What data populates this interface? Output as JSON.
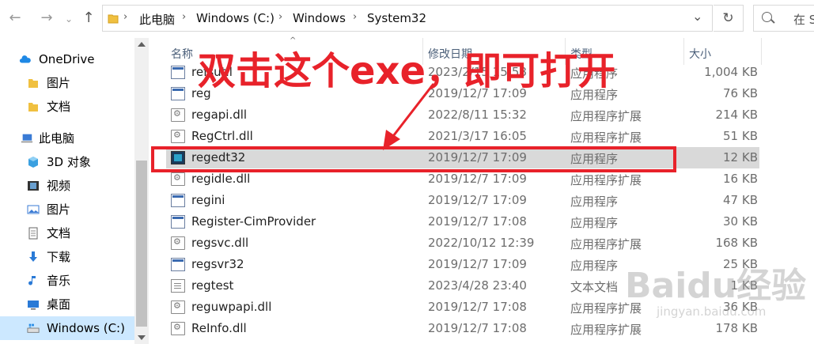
{
  "addressbar": {
    "back_glyph": "←",
    "forward_glyph": "→",
    "up_glyph": "↑",
    "path": [
      "此电脑",
      "Windows (C:)",
      "Windows",
      "System32"
    ],
    "separator": "›",
    "dropdown_glyph": "⌄",
    "refresh_glyph": "↻",
    "search_placeholder": "在 S"
  },
  "sidebar": {
    "items": [
      {
        "label": "OneDrive",
        "icon": "cloud-icon",
        "color": "#1e88e5"
      },
      {
        "label": "图片",
        "icon": "folder-icon",
        "color": "#f0c040"
      },
      {
        "label": "文档",
        "icon": "folder-icon",
        "color": "#f0c040"
      },
      {
        "label": "此电脑",
        "icon": "computer-icon",
        "color": "#3a7bd5"
      },
      {
        "label": "3D 对象",
        "icon": "cube-icon",
        "color": "#3aa0e0"
      },
      {
        "label": "视频",
        "icon": "film-icon",
        "color": "#333333"
      },
      {
        "label": "图片",
        "icon": "pictures-icon",
        "color": "#3a7bd5"
      },
      {
        "label": "文档",
        "icon": "document-icon",
        "color": "#666666"
      },
      {
        "label": "下载",
        "icon": "download-icon",
        "color": "#2a7ad6"
      },
      {
        "label": "音乐",
        "icon": "music-icon",
        "color": "#2a7ad6"
      },
      {
        "label": "桌面",
        "icon": "desktop-icon",
        "color": "#2a7ad6"
      },
      {
        "label": "Windows (C:)",
        "icon": "drive-icon",
        "color": "#555555"
      }
    ]
  },
  "columns": {
    "name": "名称",
    "date": "修改日期",
    "type": "类型",
    "size": "大小"
  },
  "files": [
    {
      "name": "refsutil",
      "date": "2023/2/15 15:58",
      "type": "应用程序",
      "size": "1,004 KB",
      "icon": "exe"
    },
    {
      "name": "reg",
      "date": "2019/12/7 17:09",
      "type": "应用程序",
      "size": "76 KB",
      "icon": "exe"
    },
    {
      "name": "regapi.dll",
      "date": "2022/8/11 15:32",
      "type": "应用程序扩展",
      "size": "214 KB",
      "icon": "dll"
    },
    {
      "name": "RegCtrl.dll",
      "date": "2021/3/17 16:05",
      "type": "应用程序扩展",
      "size": "51 KB",
      "icon": "dll"
    },
    {
      "name": "regedt32",
      "date": "2019/12/7 17:09",
      "type": "应用程序",
      "size": "12 KB",
      "icon": "reg",
      "selected": true
    },
    {
      "name": "regidle.dll",
      "date": "2019/12/7 17:09",
      "type": "应用程序扩展",
      "size": "16 KB",
      "icon": "dll"
    },
    {
      "name": "regini",
      "date": "2019/12/7 17:09",
      "type": "应用程序",
      "size": "47 KB",
      "icon": "exe"
    },
    {
      "name": "Register-CimProvider",
      "date": "2019/12/7 17:08",
      "type": "应用程序",
      "size": "30 KB",
      "icon": "exe"
    },
    {
      "name": "regsvc.dll",
      "date": "2022/10/12 12:39",
      "type": "应用程序扩展",
      "size": "168 KB",
      "icon": "dll"
    },
    {
      "name": "regsvr32",
      "date": "2019/12/7 17:09",
      "type": "应用程序",
      "size": "25 KB",
      "icon": "exe"
    },
    {
      "name": "regtest",
      "date": "2023/4/28 23:40",
      "type": "文本文档",
      "size": "1 KB",
      "icon": "txt"
    },
    {
      "name": "reguwpapi.dll",
      "date": "2019/12/7 17:08",
      "type": "应用程序扩展",
      "size": "36 KB",
      "icon": "dll"
    },
    {
      "name": "ReInfo.dll",
      "date": "2019/12/7 17:08",
      "type": "应用程序扩展",
      "size": "178 KB",
      "icon": "dll"
    }
  ],
  "annotation": {
    "text": "双击这个exe，即可打开",
    "color": "#e8222a"
  },
  "watermark": {
    "brand": "Baidu经验",
    "url": "jingyan.baidu.com"
  }
}
